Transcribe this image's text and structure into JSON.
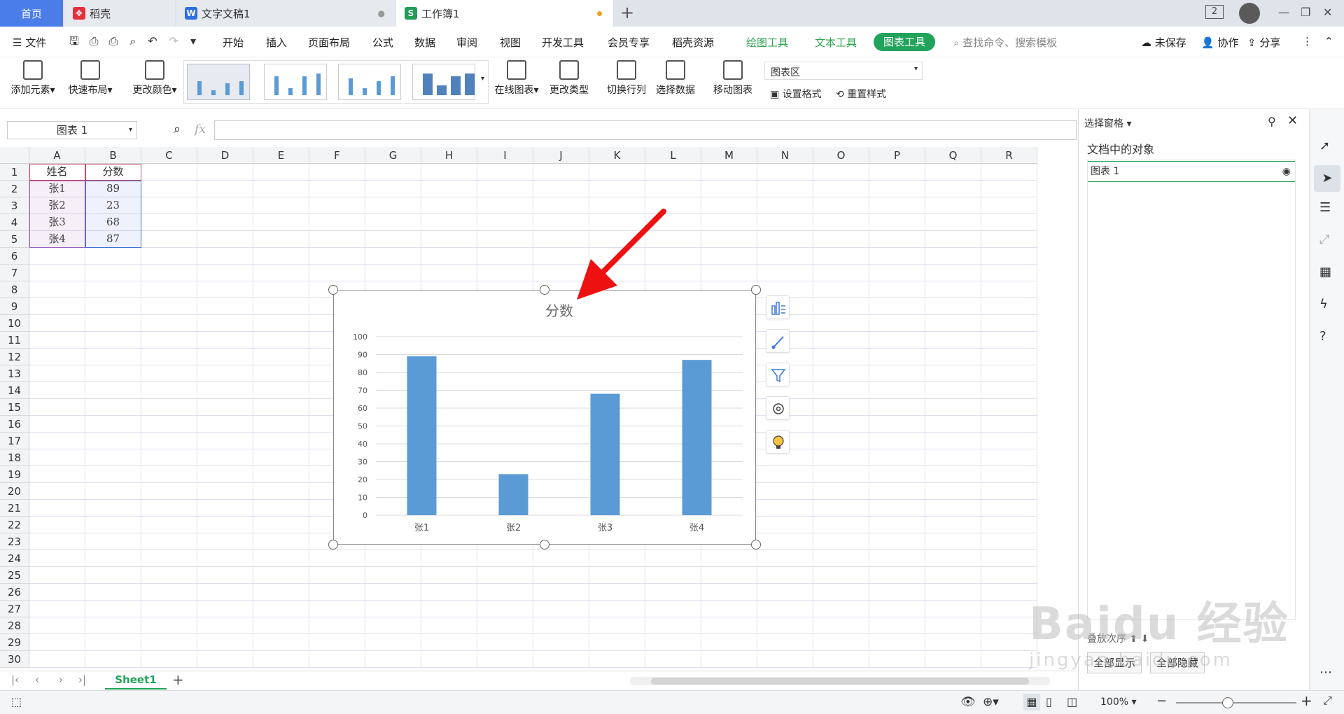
{
  "tabs": {
    "home": "首页",
    "daoke": "稻壳",
    "doc": "文字文稿1",
    "workbook": "工作簿1"
  },
  "window": {
    "badge": "2"
  },
  "menu": {
    "file": "文件",
    "items": [
      "开始",
      "插入",
      "页面布局",
      "公式",
      "数据",
      "审阅",
      "视图",
      "开发工具",
      "会员专享",
      "稻壳资源"
    ],
    "draw_tools": "绘图工具",
    "text_tools": "文本工具",
    "chart_tools": "图表工具",
    "search_placeholder": "查找命令、搜索模板",
    "unsaved": "未保存",
    "collab": "协作",
    "share": "分享"
  },
  "ribbon": {
    "add_element": "添加元素",
    "quick_layout": "快速布局",
    "change_color": "更改颜色",
    "online_chart": "在线图表",
    "change_type": "更改类型",
    "switch_rowcol": "切换行列",
    "select_data": "选择数据",
    "move_chart": "移动图表",
    "chart_area": "图表区",
    "set_format": "设置格式",
    "reset_style": "重置样式"
  },
  "formula_bar": {
    "name_box": "图表 1",
    "fx": "fx"
  },
  "columns": [
    "A",
    "B",
    "C",
    "D",
    "E",
    "F",
    "G",
    "H",
    "I",
    "J",
    "K",
    "L",
    "M",
    "N",
    "O",
    "P",
    "Q",
    "R"
  ],
  "rows": [
    "1",
    "2",
    "3",
    "4",
    "5",
    "6",
    "7",
    "8",
    "9",
    "10",
    "11",
    "12",
    "13",
    "14",
    "15",
    "16",
    "17",
    "18",
    "19",
    "20",
    "21",
    "22",
    "23",
    "24",
    "25",
    "26",
    "27",
    "28",
    "29",
    "30"
  ],
  "cells": {
    "A1": "姓名",
    "B1": "分数",
    "A2": "张1",
    "B2": "89",
    "A3": "张2",
    "B3": "23",
    "A4": "张3",
    "B4": "68",
    "A5": "张4",
    "B5": "87"
  },
  "chart_data": {
    "type": "bar",
    "title": "分数",
    "categories": [
      "张1",
      "张2",
      "张3",
      "张4"
    ],
    "values": [
      89,
      23,
      68,
      87
    ],
    "ylim": [
      0,
      100
    ],
    "yticks": [
      "0",
      "10",
      "20",
      "30",
      "40",
      "50",
      "60",
      "70",
      "80",
      "90",
      "100"
    ],
    "grid": true,
    "bar_color": "#5b9bd5"
  },
  "panel": {
    "title": "选择窗格",
    "section": "文档中的对象",
    "object": "图表 1",
    "order_label": "叠放次序",
    "show_all": "全部显示",
    "hide_all": "全部隐藏"
  },
  "sheet": {
    "name": "Sheet1"
  },
  "status": {
    "zoom": "100%"
  },
  "watermark": {
    "brand": "Baidu",
    "sub": "经验",
    "url": "jingyan.baidu.com"
  },
  "colors": {
    "accent_green": "#21a35b",
    "tab_blue": "#4a7de8",
    "annotation_arrow": "#ee1111"
  }
}
